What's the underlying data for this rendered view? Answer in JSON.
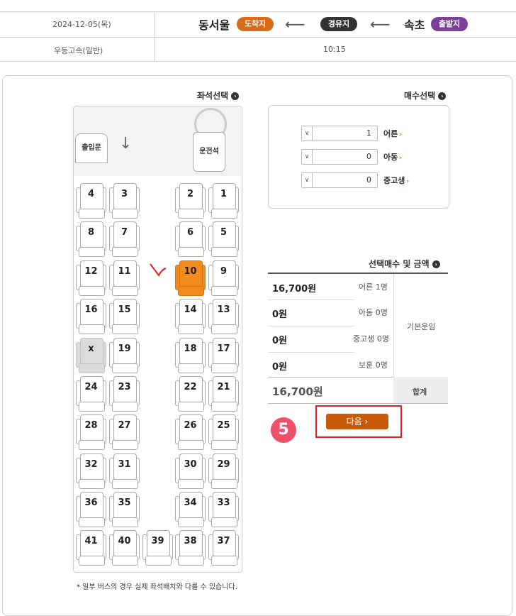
{
  "route": {
    "date": "2024-12-05(목)",
    "origin_badge": "출발지",
    "origin": "속초",
    "via_badge": "경유지",
    "dest_badge": "도착지",
    "dest": "동서울",
    "bus_class": "우등고속(일반)",
    "time": "10:15",
    "colors": {
      "origin": "#7b3f98",
      "via": "#333333",
      "dest": "#d86a1a"
    }
  },
  "seat_section": {
    "title": "좌석선택",
    "entrance_label": "출입문",
    "driver_label": "운전석",
    "seats": [
      {
        "num": "1",
        "state": "normal"
      },
      {
        "num": "2",
        "state": "normal"
      },
      {
        "num": "3",
        "state": "normal"
      },
      {
        "num": "4",
        "state": "normal"
      },
      {
        "num": "5",
        "state": "normal"
      },
      {
        "num": "6",
        "state": "normal"
      },
      {
        "num": "7",
        "state": "normal"
      },
      {
        "num": "8",
        "state": "normal"
      },
      {
        "num": "9",
        "state": "normal"
      },
      {
        "num": "10",
        "state": "selected"
      },
      {
        "num": "11",
        "state": "normal"
      },
      {
        "num": "12",
        "state": "normal"
      },
      {
        "num": "13",
        "state": "normal"
      },
      {
        "num": "14",
        "state": "normal"
      },
      {
        "num": "15",
        "state": "normal"
      },
      {
        "num": "16",
        "state": "normal"
      },
      {
        "num": "17",
        "state": "normal"
      },
      {
        "num": "18",
        "state": "normal"
      },
      {
        "num": "19",
        "state": "normal"
      },
      {
        "num": "x",
        "state": "disabled"
      },
      {
        "num": "21",
        "state": "normal"
      },
      {
        "num": "22",
        "state": "normal"
      },
      {
        "num": "23",
        "state": "normal"
      },
      {
        "num": "24",
        "state": "normal"
      },
      {
        "num": "25",
        "state": "normal"
      },
      {
        "num": "26",
        "state": "normal"
      },
      {
        "num": "27",
        "state": "normal"
      },
      {
        "num": "28",
        "state": "normal"
      },
      {
        "num": "29",
        "state": "normal"
      },
      {
        "num": "30",
        "state": "normal"
      },
      {
        "num": "31",
        "state": "normal"
      },
      {
        "num": "32",
        "state": "normal"
      },
      {
        "num": "33",
        "state": "normal"
      },
      {
        "num": "34",
        "state": "normal"
      },
      {
        "num": "35",
        "state": "normal"
      },
      {
        "num": "36",
        "state": "normal"
      },
      {
        "num": "37",
        "state": "normal"
      },
      {
        "num": "38",
        "state": "normal"
      },
      {
        "num": "39",
        "state": "normal"
      },
      {
        "num": "40",
        "state": "normal"
      },
      {
        "num": "41",
        "state": "normal"
      }
    ],
    "note1": "* 일부 버스의 경우 실제 좌석배치와 다를 수 있습니다.",
    "selected_color": "#f28b1f"
  },
  "ticket_section": {
    "title": "매수선택",
    "rows": [
      {
        "label": "어른",
        "value": "1"
      },
      {
        "label": "아동",
        "value": "0"
      },
      {
        "label": "중고생",
        "value": "0"
      }
    ]
  },
  "fare_section": {
    "title": "선택매수 및 금액",
    "group_label": "기본운임",
    "rows": [
      {
        "label": "어른 1명",
        "amount": "16,700원"
      },
      {
        "label": "아동 0명",
        "amount": "0원"
      },
      {
        "label": "중고생 0명",
        "amount": "0원"
      },
      {
        "label": "보훈 0명",
        "amount": "0원"
      }
    ],
    "total_label": "합계",
    "total": "16,700원"
  },
  "next_button": "다음 ›",
  "step_number": "5"
}
